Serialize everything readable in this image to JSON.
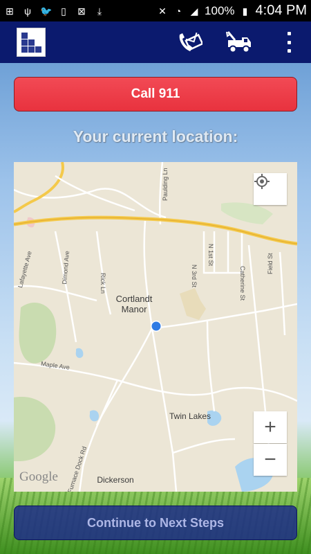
{
  "status_bar": {
    "battery": "100%",
    "time": "4:04 PM"
  },
  "actions": {
    "call_label": "Call 911",
    "location_heading": "Your current location:",
    "continue_label": "Continue to Next Steps"
  },
  "map": {
    "place": "Cortlandt Manor",
    "lake": "Twin Lakes",
    "area": "Dickerson",
    "streets": [
      "Paulding Ln",
      "N 3rd St",
      "N 1st St",
      "Lafayette Ave",
      "Dimond Ave",
      "Rick Ln",
      "Catherine St",
      "Field St",
      "Maple Ave",
      "Furnace Dock Rd"
    ],
    "attribution": "Google",
    "zoom_in": "+",
    "zoom_out": "−"
  },
  "colors": {
    "action_bar": "#0b1a6e",
    "call_button": "#e8323e",
    "continue_button": "#1c288c",
    "location_dot": "#2f7be4"
  }
}
